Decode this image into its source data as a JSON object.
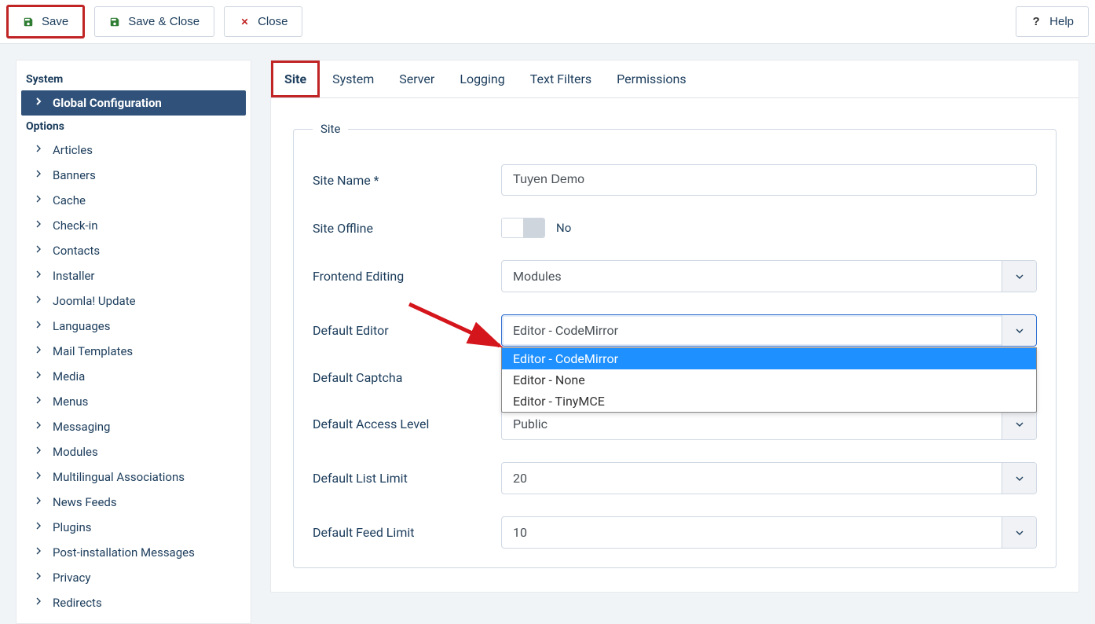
{
  "toolbar": {
    "save": "Save",
    "save_close": "Save & Close",
    "close": "Close",
    "help": "Help"
  },
  "sidebar": {
    "heading_system": "System",
    "global_config": "Global Configuration",
    "heading_options": "Options",
    "items": [
      "Articles",
      "Banners",
      "Cache",
      "Check-in",
      "Contacts",
      "Installer",
      "Joomla! Update",
      "Languages",
      "Mail Templates",
      "Media",
      "Menus",
      "Messaging",
      "Modules",
      "Multilingual Associations",
      "News Feeds",
      "Plugins",
      "Post-installation Messages",
      "Privacy",
      "Redirects"
    ]
  },
  "tabs": [
    "Site",
    "System",
    "Server",
    "Logging",
    "Text Filters",
    "Permissions"
  ],
  "fieldset_legend": "Site",
  "fields": {
    "site_name_label": "Site Name *",
    "site_name_value": "Tuyen Demo",
    "site_offline_label": "Site Offline",
    "site_offline_value": "No",
    "frontend_editing_label": "Frontend Editing",
    "frontend_editing_value": "Modules",
    "default_editor_label": "Default Editor",
    "default_editor_value": "Editor - CodeMirror",
    "default_editor_options": [
      "Editor - CodeMirror",
      "Editor - None",
      "Editor - TinyMCE"
    ],
    "default_captcha_label": "Default Captcha",
    "default_access_label": "Default Access Level",
    "default_access_value": "Public",
    "default_list_limit_label": "Default List Limit",
    "default_list_limit_value": "20",
    "default_feed_limit_label": "Default Feed Limit",
    "default_feed_limit_value": "10"
  }
}
